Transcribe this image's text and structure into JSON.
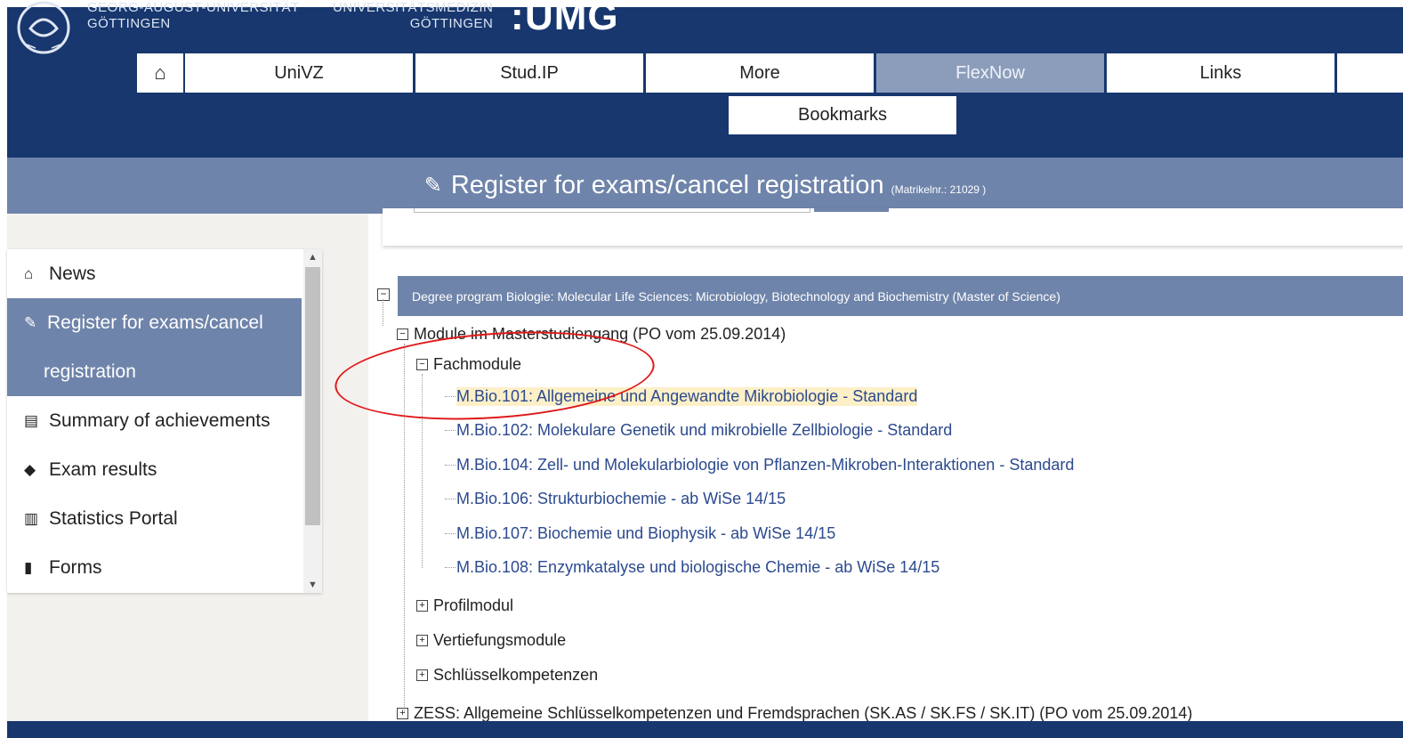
{
  "header": {
    "uni_line1": "GEORG-AUGUST-UNIVERSITÄT",
    "uni_line2": "GÖTTINGEN",
    "med_line1": "UNIVERSITÄTSMEDIZIN",
    "med_line2": "GÖTTINGEN",
    "umg": "UMG"
  },
  "nav": {
    "home_icon": "home-icon",
    "items": [
      "UniVZ",
      "Stud.IP",
      "More",
      "FlexNow",
      "Links"
    ],
    "active": "FlexNow",
    "bookmarks": "Bookmarks"
  },
  "title": {
    "icon": "edit-icon",
    "main": "Register for exams/cancel registration",
    "matrikel": "(Matrikelnr.: 21029 )"
  },
  "sidebar": {
    "items": [
      {
        "icon": "home-icon",
        "label": "News"
      },
      {
        "icon": "edit-icon",
        "label": "Register for exams/cancel",
        "label2": "registration"
      },
      {
        "icon": "list-icon",
        "label": "Summary of achievements"
      },
      {
        "icon": "graduation-cap-icon",
        "label": "Exam results"
      },
      {
        "icon": "bar-chart-icon",
        "label": "Statistics Portal"
      },
      {
        "icon": "file-icon",
        "label": "Forms"
      }
    ]
  },
  "tree": {
    "degree": "Degree program Biologie: Molecular Life Sciences: Microbiology, Biotechnology and Biochemistry (Master of Science)",
    "module_group": "Module im Masterstudiengang (PO vom 25.09.2014)",
    "fachmodule": "Fachmodule",
    "modules": [
      "M.Bio.101: Allgemeine und Angewandte Mikrobiologie - Standard",
      "M.Bio.102: Molekulare Genetik und mikrobielle Zellbiologie - Standard",
      "M.Bio.104: Zell- und Molekularbiologie von Pflanzen-Mikroben-Interaktionen - Standard",
      "M.Bio.106: Strukturbiochemie - ab WiSe 14/15",
      "M.Bio.107: Biochemie und Biophysik - ab WiSe 14/15",
      "M.Bio.108: Enzymkatalyse und biologische Chemie - ab WiSe 14/15"
    ],
    "collapsed": [
      "Profilmodul",
      "Vertiefungsmodule",
      "Schlüsselkompetenzen"
    ],
    "zess": "ZESS: Allgemeine Schlüsselkompetenzen und Fremdsprachen (SK.AS / SK.FS / SK.IT) (PO vom 25.09.2014)"
  },
  "colors": {
    "header": "#17376e",
    "title_bar": "#6f84aa",
    "highlight": "#fdf0c8",
    "annotation": "#e01818"
  }
}
